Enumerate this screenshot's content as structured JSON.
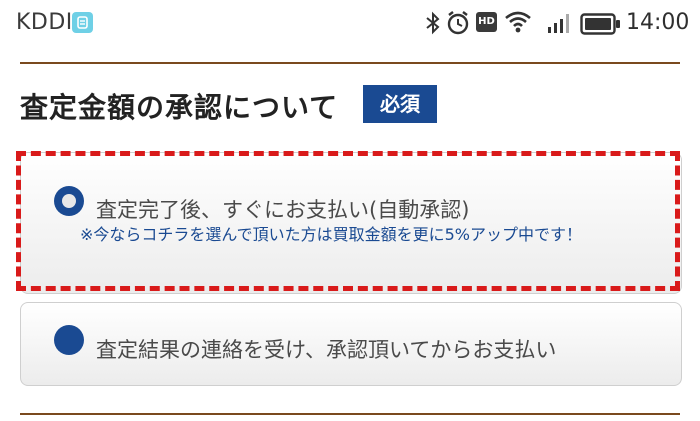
{
  "status_bar": {
    "carrier": "KDDI",
    "hd_label": "HD",
    "time": "14:00",
    "icons": [
      "bluetooth-icon",
      "alarm-icon",
      "hd-voice-icon",
      "wifi-icon",
      "signal-icon",
      "battery-icon"
    ]
  },
  "section": {
    "title": "査定金額の承認について",
    "required_badge": "必須"
  },
  "options": [
    {
      "label": "査定完了後、すぐにお支払い(自動承認)",
      "note": "※今ならコチラを選んで頂いた方は買取金額を更に5%アップ中です！",
      "selected": true
    },
    {
      "label": "査定結果の連絡を受け、承認頂いてからお支払い",
      "selected": false
    }
  ],
  "colors": {
    "accent": "#1a4a92",
    "rule": "#7a4a1e",
    "highlight_outline": "#d91a1a",
    "carrier_badge": "#6fd0e6"
  }
}
